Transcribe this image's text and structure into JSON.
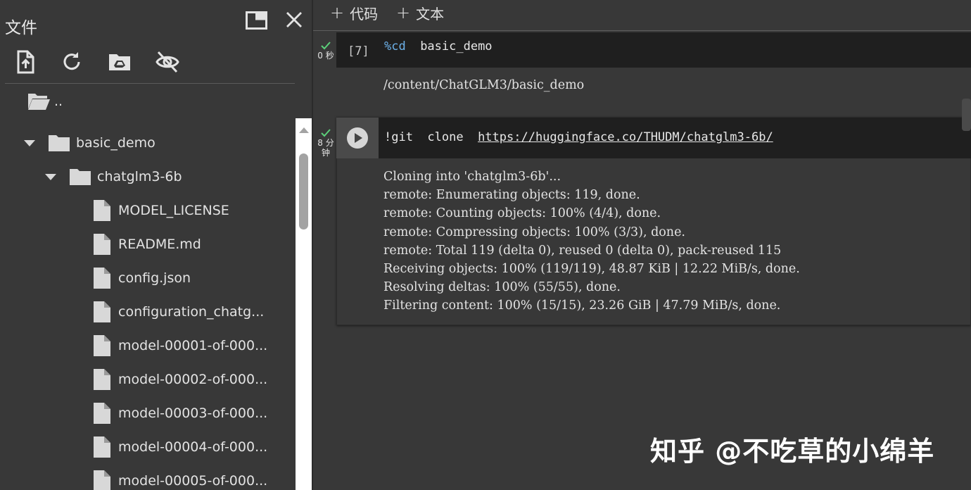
{
  "sidebar": {
    "title": "文件",
    "tree": [
      {
        "label": "..",
        "type": "folder-open"
      },
      {
        "label": "basic_demo",
        "type": "folder",
        "expanded": true
      },
      {
        "label": "chatglm3-6b",
        "type": "folder",
        "expanded": true
      },
      {
        "label": "MODEL_LICENSE",
        "type": "file"
      },
      {
        "label": "README.md",
        "type": "file"
      },
      {
        "label": "config.json",
        "type": "file"
      },
      {
        "label": "configuration_chatg...",
        "type": "file"
      },
      {
        "label": "model-00001-of-000...",
        "type": "file"
      },
      {
        "label": "model-00002-of-000...",
        "type": "file"
      },
      {
        "label": "model-00003-of-000...",
        "type": "file"
      },
      {
        "label": "model-00004-of-000...",
        "type": "file"
      },
      {
        "label": "model-00005-of-000...",
        "type": "file"
      }
    ]
  },
  "toolbar": {
    "add_code": "代码",
    "add_text": "文本",
    "plus": "+"
  },
  "cells": [
    {
      "status_time": "0 秒",
      "exec_count": "[7]",
      "code_magic": "%cd",
      "code_rest": "  basic_demo",
      "output": "/content/ChatGLM3/basic_demo"
    },
    {
      "status_time_1": "8 分",
      "status_time_2": "钟",
      "code_cmd": "!git  clone  ",
      "code_link": "https://huggingface.co/THUDM/chatglm3-6b/",
      "output": "Cloning into 'chatglm3-6b'...\nremote: Enumerating objects: 119, done.\nremote: Counting objects: 100% (4/4), done.\nremote: Compressing objects: 100% (3/3), done.\nremote: Total 119 (delta 0), reused 0 (delta 0), pack-reused 115\nReceiving objects: 100% (119/119), 48.87 KiB | 12.22 MiB/s, done.\nResolving deltas: 100% (55/55), done.\nFiltering content: 100% (15/15), 23.26 GiB | 47.79 MiB/s, done."
    }
  ],
  "watermark": "知乎 @不吃草的小绵羊",
  "colors": {
    "background": "#383838",
    "code_bg": "#1f1f1f",
    "check_green": "#5bd07a",
    "magic_blue": "#6cb0e8"
  }
}
